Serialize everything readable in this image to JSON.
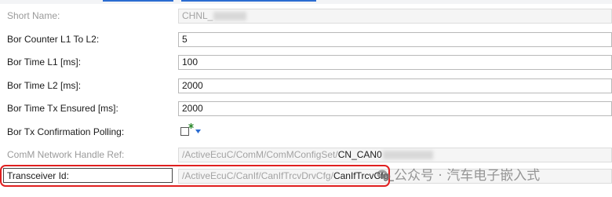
{
  "fields": [
    {
      "label": "Short Name:",
      "value": "CHNL_",
      "disabled": true
    },
    {
      "label": "Bor Counter L1 To L2:",
      "value": "5",
      "disabled": false
    },
    {
      "label": "Bor Time L1 [ms]:",
      "value": "100",
      "disabled": false
    },
    {
      "label": "Bor Time L2 [ms]:",
      "value": "2000",
      "disabled": false
    },
    {
      "label": "Bor Time Tx Ensured [ms]:",
      "value": "2000",
      "disabled": false
    },
    {
      "label": "Bor Tx Confirmation Polling:",
      "value": "",
      "disabled": false
    },
    {
      "label": "ComM Network Handle Ref:",
      "value_prefix": "/ActiveEcuC/ComM/ComMConfigSet/",
      "value_tail": "CN_CAN0",
      "disabled": true
    },
    {
      "label": "Transceiver Id:",
      "value_prefix": "/ActiveEcuC/CanIf/CanIfTrcvDrvCfg/",
      "value_tail": "CanIfTrcvCfg_",
      "disabled": true
    }
  ],
  "checkbox": {
    "checked": false
  },
  "watermark": {
    "text": "公众号 · 汽车电子嵌入式"
  },
  "colors": {
    "highlight": "#e02020",
    "link": "#2b6cd1",
    "disabled_text": "#9a9a9a"
  }
}
